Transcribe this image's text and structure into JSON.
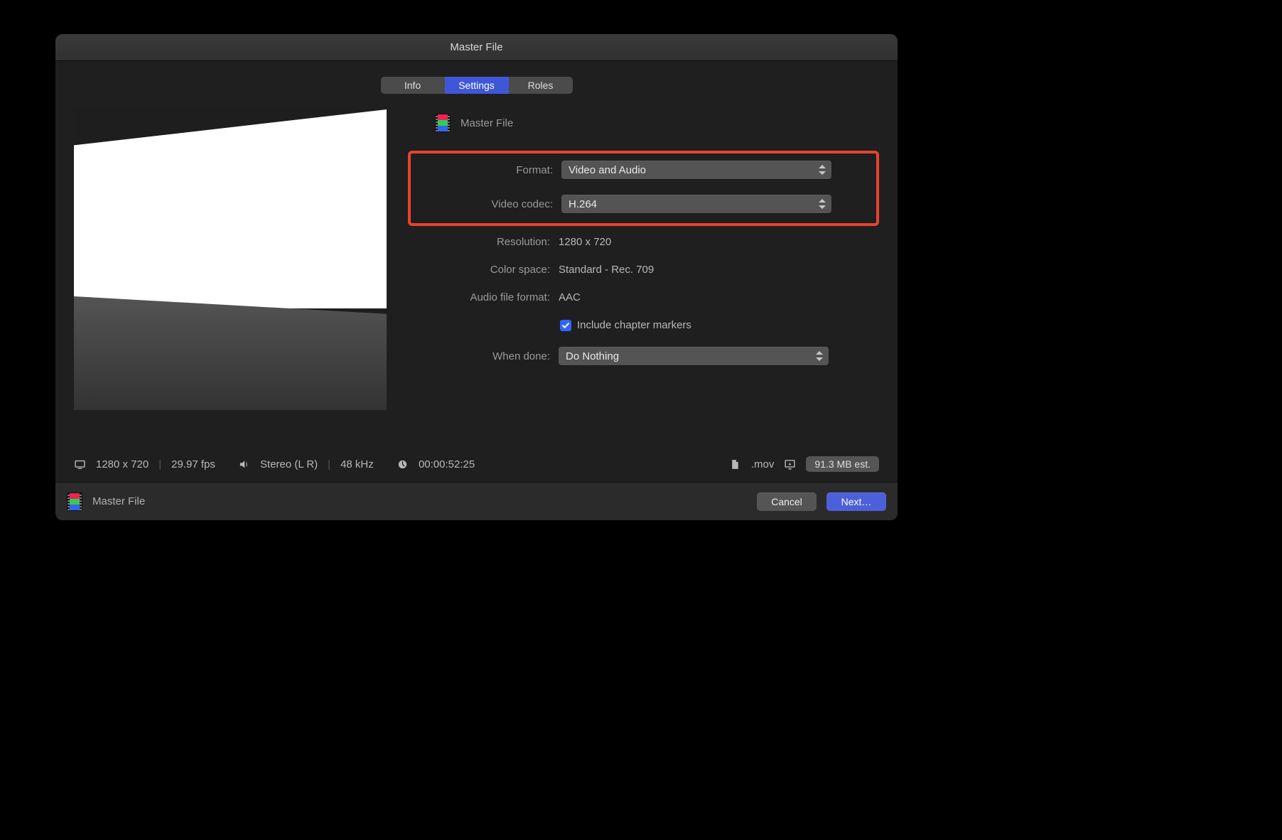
{
  "window": {
    "title": "Master File"
  },
  "tabs": {
    "info": "Info",
    "settings": "Settings",
    "roles": "Roles"
  },
  "header": {
    "title": "Master File"
  },
  "labels": {
    "format": "Format:",
    "video_codec": "Video codec:",
    "resolution": "Resolution:",
    "color_space": "Color space:",
    "audio_format": "Audio file format:",
    "when_done": "When done:"
  },
  "values": {
    "format": "Video and Audio",
    "video_codec": "H.264",
    "resolution": "1280 x 720",
    "color_space": "Standard - Rec. 709",
    "audio_format": "AAC",
    "when_done": "Do Nothing"
  },
  "chapter": {
    "label": "Include chapter markers",
    "checked": true
  },
  "info": {
    "dimensions": "1280 x 720",
    "fps": "29.97 fps",
    "audio": "Stereo (L R)",
    "khz": "48 kHz",
    "duration": "00:00:52:25",
    "ext": ".mov",
    "size": "91.3 MB est."
  },
  "footer": {
    "title": "Master File",
    "cancel": "Cancel",
    "next": "Next…"
  }
}
